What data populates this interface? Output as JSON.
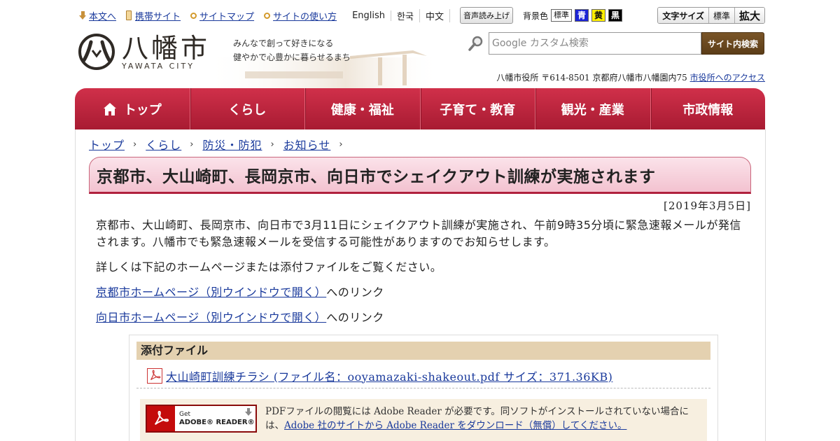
{
  "utility": {
    "text_only": "本文へ",
    "mobile": "携帯サイト",
    "sitemap": "サイトマップ",
    "howto": "サイトの使い方",
    "lang_en": "English",
    "lang_ko": "한국",
    "lang_zh": "中文",
    "voice": "音声読み上げ",
    "bg_label": "背景色",
    "bg_std": "標準",
    "bg_blue": "青",
    "bg_yellow": "黄",
    "bg_black": "黒",
    "font_label": "文字サイズ",
    "font_std": "標準",
    "font_big": "拡大"
  },
  "header": {
    "logo_jp": "八幡市",
    "logo_en": "YAWATA CITY",
    "tagline_1": "みんなで創って好きになる",
    "tagline_2": "健やかで心豊かに暮らせるまち",
    "search_placeholder": "Google カスタム検索",
    "search_button": "サイト内検索",
    "address": "八幡市役所 〒614-8501 京都府八幡市八幡園内75 ",
    "access_link": "市役所へのアクセス"
  },
  "nav": {
    "items": [
      "トップ",
      "くらし",
      "健康・福祉",
      "子育て・教育",
      "観光・産業",
      "市政情報"
    ]
  },
  "breadcrumb": [
    "トップ",
    "くらし",
    "防災・防犯",
    "お知らせ"
  ],
  "article": {
    "title": "京都市、大山崎町、長岡京市、向日市でシェイクアウト訓練が実施されます",
    "date": "[2019年3月5日]",
    "para1": "京都市、大山崎町、長岡京市、向日市で3月11日にシェイクアウト訓練が実施され、午前9時35分頃に緊急速報メールが発信されます。八幡市でも緊急速報メールを受信する可能性がありますのでお知らせします。",
    "para2": "詳しくは下記のホームページまたは添付ファイルをご覧ください。",
    "link1": "京都市ホームページ（別ウインドウで開く）",
    "link2": "向日市ホームページ（別ウインドウで開く）",
    "link_suffix": "へのリンク"
  },
  "attachment": {
    "heading": "添付ファイル",
    "file_link": "大山崎町訓練チラシ (ファイル名：ooyamazaki-shakeout.pdf サイズ：371.36KB)",
    "badge_get": "Get",
    "badge_name": "ADOBE® READER®",
    "reader_text": "PDFファイルの閲覧には Adobe Reader が必要です。同ソフトがインストールされていない場合には、",
    "reader_link": "Adobe 社のサイトから Adobe Reader をダウンロード（無償）してください。"
  },
  "colors": {
    "nav_red": "#b5213a",
    "title_pink": "#f3c2d0",
    "attach_tan": "#e4d1b0",
    "link_blue": "#1a3a9c"
  }
}
